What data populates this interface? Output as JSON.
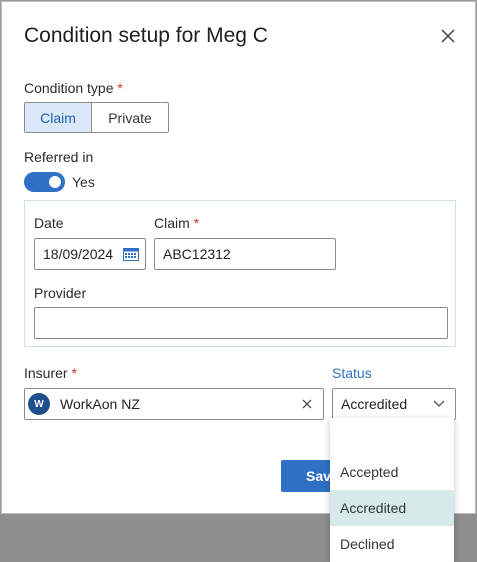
{
  "dialog": {
    "title": "Condition setup for Meg C",
    "close_icon": "close-icon"
  },
  "condition_type": {
    "label": "Condition type",
    "required_mark": "*",
    "options": [
      "Claim",
      "Private"
    ],
    "selected": "Claim"
  },
  "referred_in": {
    "label": "Referred in",
    "toggle_on": true,
    "toggle_text": "Yes"
  },
  "referral": {
    "date_label": "Date",
    "date_value": "18/09/2024",
    "calendar_icon": "calendar-icon",
    "claim_label": "Claim",
    "claim_required_mark": "*",
    "claim_value": "ABC12312",
    "provider_label": "Provider",
    "provider_value": ""
  },
  "insurer": {
    "label": "Insurer",
    "required_mark": "*",
    "avatar_initial": "W",
    "value": "WorkAon NZ",
    "clear_icon": "clear-icon"
  },
  "status": {
    "label": "Status",
    "value": "Accredited",
    "chevron_icon": "chevron-down-icon",
    "options": [
      "Accepted",
      "Accredited",
      "Declined"
    ],
    "selected": "Accredited"
  },
  "footer": {
    "save_label": "Save"
  },
  "colors": {
    "accent": "#2f6fc4",
    "selected_option_bg": "#d6eaea",
    "required": "#c0392b"
  }
}
